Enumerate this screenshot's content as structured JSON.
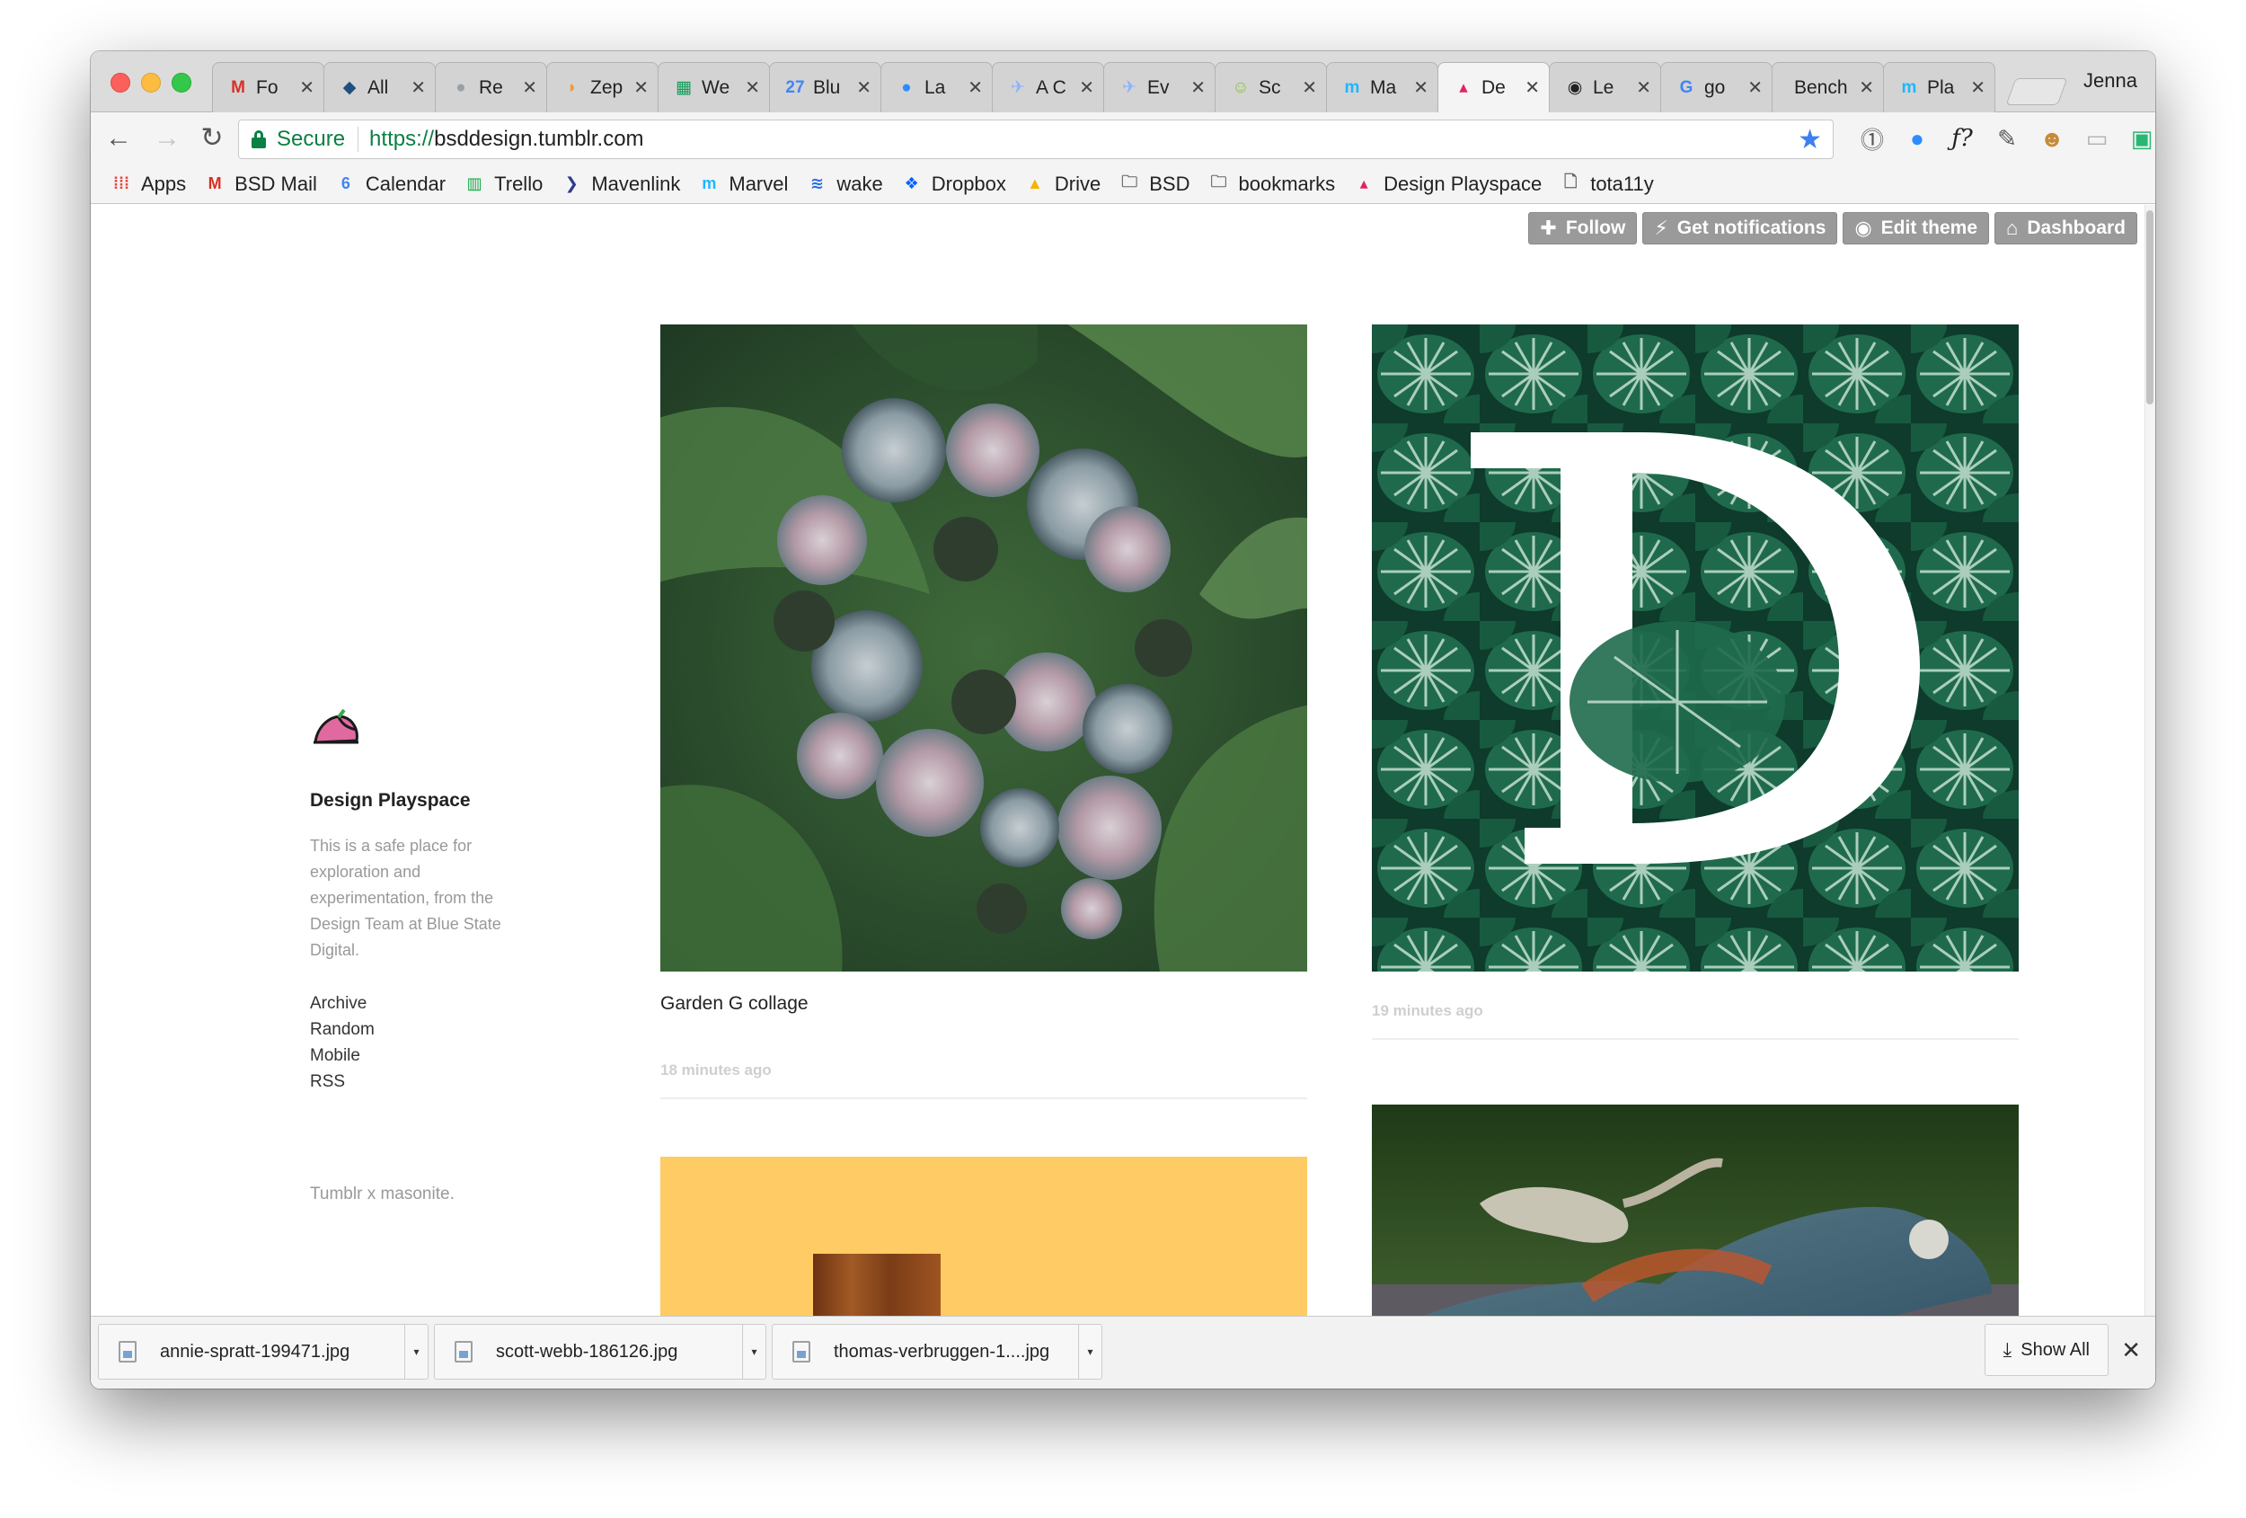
{
  "browser": {
    "profile_name": "Jenna",
    "tabs": [
      {
        "label": "Fo",
        "icon": "gmail-icon",
        "glyph": "M",
        "color": "#d93025"
      },
      {
        "label": "All",
        "icon": "confluence-icon",
        "glyph": "◆",
        "color": "#205081"
      },
      {
        "label": "Re",
        "icon": "loading-icon",
        "glyph": "●",
        "color": "#9aa0a6"
      },
      {
        "label": "Zep",
        "icon": "zeplin-icon",
        "glyph": "◗",
        "color": "#f69833"
      },
      {
        "label": "We",
        "icon": "sheets-icon",
        "glyph": "▦",
        "color": "#0f9d58"
      },
      {
        "label": "Blu",
        "icon": "calendar-icon",
        "glyph": "27",
        "color": "#4285f4"
      },
      {
        "label": "La",
        "icon": "zoom-icon",
        "glyph": "●",
        "color": "#2d8cff"
      },
      {
        "label": "A C",
        "icon": "airtable-icon",
        "glyph": "✈",
        "color": "#8ab4f8"
      },
      {
        "label": "Ev",
        "icon": "airtable-icon",
        "glyph": "✈",
        "color": "#8ab4f8"
      },
      {
        "label": "Sc",
        "icon": "scoop-icon",
        "glyph": "☺",
        "color": "#8bc34a"
      },
      {
        "label": "Ma",
        "icon": "marvel-icon",
        "glyph": "m",
        "color": "#1fb6ff"
      },
      {
        "label": "De",
        "icon": "tumblr-icon",
        "glyph": "▴",
        "color": "#e0245e"
      },
      {
        "label": "Le",
        "icon": "camera-icon",
        "glyph": "◉",
        "color": "#222222"
      },
      {
        "label": "go",
        "icon": "google-icon",
        "glyph": "G",
        "color": "#4285f4"
      },
      {
        "label": "Bench",
        "icon": "",
        "glyph": "",
        "color": "#222222"
      },
      {
        "label": "Pla",
        "icon": "marvel-icon",
        "glyph": "m",
        "color": "#1fb6ff"
      }
    ],
    "active_tab": 11,
    "omnibox": {
      "secure_label": "Secure",
      "url_scheme": "https://",
      "url_host": "bsddesign.tumblr.com"
    },
    "bookmarks": [
      {
        "label": "Apps",
        "icon": "apps-grid-icon",
        "glyph": "⁞⁞⁞",
        "color": "#e8453c"
      },
      {
        "label": "BSD Mail",
        "icon": "gmail-icon",
        "glyph": "M",
        "color": "#d93025"
      },
      {
        "label": "Calendar",
        "icon": "calendar-icon",
        "glyph": "6",
        "color": "#4285f4"
      },
      {
        "label": "Trello",
        "icon": "trello-icon",
        "glyph": "▥",
        "color": "#0fa63f"
      },
      {
        "label": "Mavenlink",
        "icon": "mavenlink-icon",
        "glyph": "❯",
        "color": "#2e3c8c"
      },
      {
        "label": "Marvel",
        "icon": "marvel-icon",
        "glyph": "m",
        "color": "#1fb6ff"
      },
      {
        "label": "wake",
        "icon": "wake-icon",
        "glyph": "≋",
        "color": "#2b6de6"
      },
      {
        "label": "Dropbox",
        "icon": "dropbox-icon",
        "glyph": "❖",
        "color": "#0061ff"
      },
      {
        "label": "Drive",
        "icon": "drive-icon",
        "glyph": "▲",
        "color": "#f4b400"
      },
      {
        "label": "BSD",
        "icon": "folder-icon",
        "glyph": "🗀",
        "color": "#666666"
      },
      {
        "label": "bookmarks",
        "icon": "folder-icon",
        "glyph": "🗀",
        "color": "#666666"
      },
      {
        "label": "Design Playspace",
        "icon": "tumblr-icon",
        "glyph": "▴",
        "color": "#e0245e"
      },
      {
        "label": "tota11y",
        "icon": "page-icon",
        "glyph": "🗋",
        "color": "#666666"
      }
    ]
  },
  "tumblr_controls": [
    {
      "label": "Follow",
      "icon": "plus-icon",
      "glyph": "✚"
    },
    {
      "label": "Get notifications",
      "icon": "bolt-icon",
      "glyph": "⚡"
    },
    {
      "label": "Edit theme",
      "icon": "eye-icon",
      "glyph": "◉"
    },
    {
      "label": "Dashboard",
      "icon": "home-icon",
      "glyph": "⌂"
    }
  ],
  "blog": {
    "name": "Design Playspace",
    "description": "This is a safe place for exploration and experimentation, from the Design Team at Blue State Digital.",
    "links": [
      "Archive",
      "Random",
      "Mobile",
      "RSS"
    ],
    "footer": "Tumblr x masonite."
  },
  "posts": [
    {
      "caption": "Garden G collage",
      "time": "18 minutes ago"
    },
    {
      "caption": "",
      "time": "19 minutes ago"
    },
    {
      "caption": "",
      "time": ""
    },
    {
      "caption": "",
      "time": ""
    }
  ],
  "downloads": {
    "items": [
      "annie-spratt-199471.jpg",
      "scott-webb-186126.jpg",
      "thomas-verbruggen-1....jpg"
    ],
    "show_all_label": "Show All"
  }
}
